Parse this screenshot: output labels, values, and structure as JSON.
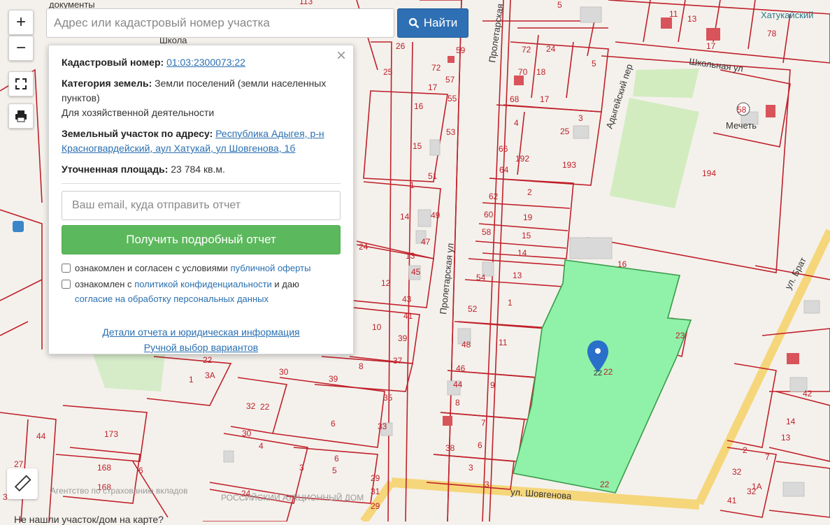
{
  "search": {
    "placeholder": "Адрес или кадастровый номер участка",
    "button_label": "Найти"
  },
  "controls": {
    "zoom_in": "+",
    "zoom_out": "−"
  },
  "popup": {
    "close": "×",
    "cadastral_label": "Кадастровый номер:",
    "cadastral_value": "01:03:2300073:22",
    "category_label": "Категория земель:",
    "category_value": "Земли поселений (земли населенных пунктов)",
    "usage_value": "Для хозяйственной деятельности",
    "address_label": "Земельный участок по адресу:",
    "address_value": "Республика Адыгея, р-н Красногвардейский, аул Хатукай, ул Шовгенова, 1б",
    "area_label": "Уточненная площадь:",
    "area_value": "23 784 кв.м.",
    "email_placeholder": "Ваш email, куда отправить отчет",
    "report_button": "Получить подробный отчет",
    "check1_text": "ознакомлен и согласен с условиями",
    "check1_link": "публичной оферты",
    "check2_text": "ознакомлен с",
    "check2_link": "политикой конфиденциальности",
    "check2_text2": "и даю",
    "check2_link2": "согласие на обработку персональных данных",
    "details_link": "Детали отчета и юридическая информация",
    "manual_link": "Ручной выбор вариантов"
  },
  "map": {
    "streets": {
      "proletarskaya_upper": "Пролетарская",
      "proletarskaya_lower": "Пролетарская ул",
      "adygeyskiy": "Адыгейский пер",
      "shkolnaya": "Школьная ул",
      "shovgenova": "ул. Шовгенова",
      "bratskaya": "ул. Брат"
    },
    "pois": {
      "mosque": "Мечеть",
      "school": "Школа",
      "hatukay": "Хатукайский",
      "documents": "документы"
    },
    "parcel_numbers": [
      "113",
      "5",
      "11",
      "13",
      "17",
      "78",
      "26",
      "59",
      "72",
      "24",
      "25",
      "72",
      "57",
      "70",
      "18",
      "5",
      "17",
      "55",
      "68",
      "17",
      "58",
      "16",
      "53",
      "4",
      "25",
      "3",
      "15",
      "66",
      "192",
      "193",
      "194",
      "51",
      "64",
      "2",
      "1",
      "62",
      "19",
      "49",
      "60",
      "15",
      "14",
      "58",
      "14",
      "47",
      "24",
      "13",
      "45",
      "54",
      "13",
      "16",
      "43",
      "52",
      "1",
      "12",
      "41",
      "10",
      "39",
      "48",
      "11",
      "23",
      "22",
      "37",
      "46",
      "9",
      "22",
      "3А",
      "30",
      "39",
      "8",
      "44",
      "42",
      "35",
      "8",
      "32",
      "22",
      "1",
      "6",
      "33",
      "7",
      "14",
      "173",
      "30",
      "6",
      "38",
      "6",
      "13",
      "44",
      "4",
      "29",
      "168",
      "6",
      "5",
      "3",
      "2",
      "7",
      "27",
      "168",
      "32",
      "3",
      "31",
      "24",
      "29",
      "3",
      "22",
      "32",
      "1А",
      "3",
      "41"
    ],
    "selected_parcel": "22"
  },
  "watermarks": {
    "agency": "Агентство по страхованию вкладов",
    "rad": "РОССИЙСКИЙ АУКЦИОННЫЙ ДОМ"
  },
  "bottom_link": "Не нашли участок/дом на карте?",
  "colors": {
    "parcel_border": "#c0202a",
    "selected_fill": "#8ff2a8",
    "selected_border": "#3a9a4a",
    "road": "#f5d67a",
    "search_button": "#2f70b5",
    "report_button": "#5cb85c",
    "pin": "#2a6fc9"
  }
}
